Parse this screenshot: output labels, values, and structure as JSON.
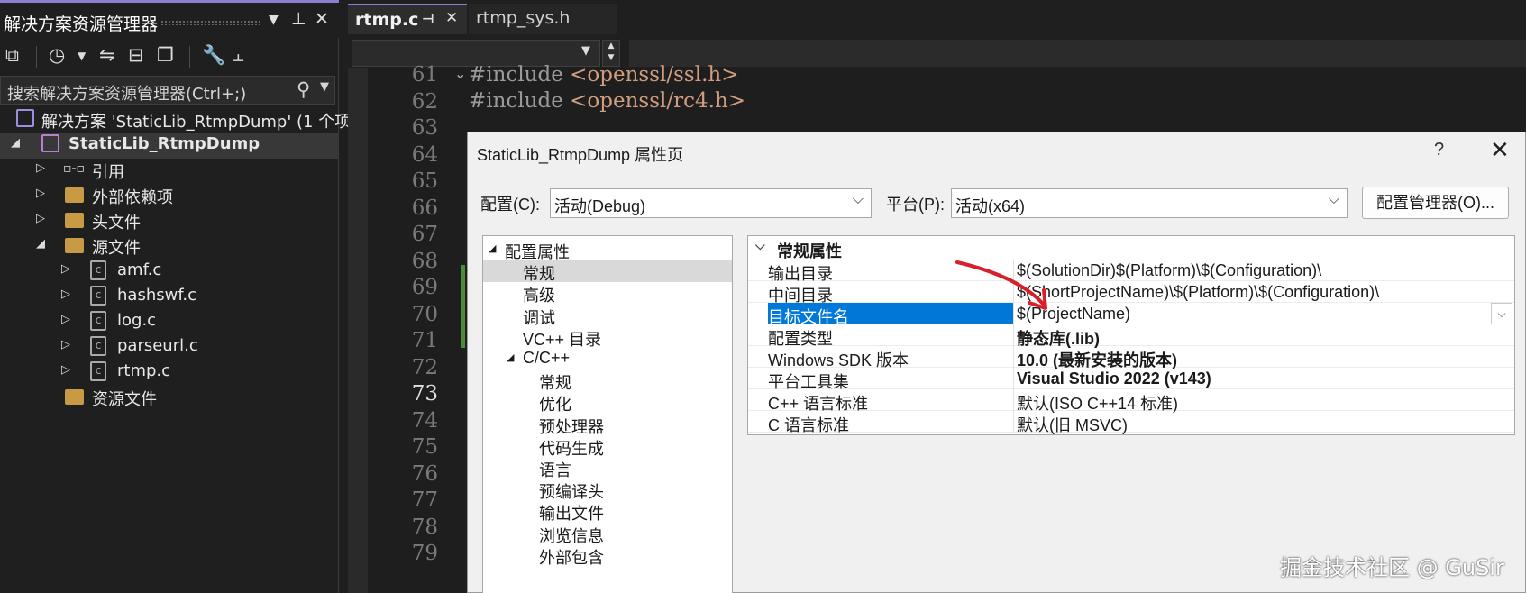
{
  "solution_explorer": {
    "title": "解决方案资源管理器",
    "search_placeholder": "搜索解决方案资源管理器(Ctrl+;)",
    "solution_label": "解决方案 'StaticLib_RtmpDump' (1 个项",
    "project_label": "StaticLib_RtmpDump",
    "items": [
      {
        "label": "引用"
      },
      {
        "label": "外部依赖项"
      },
      {
        "label": "头文件"
      },
      {
        "label": "源文件"
      },
      {
        "label": "amf.c"
      },
      {
        "label": "hashswf.c"
      },
      {
        "label": "log.c"
      },
      {
        "label": "parseurl.c"
      },
      {
        "label": "rtmp.c"
      },
      {
        "label": "资源文件"
      }
    ]
  },
  "editor": {
    "tabs": [
      {
        "label": "rtmp.c"
      },
      {
        "label": "rtmp_sys.h"
      }
    ],
    "line_numbers": [
      "61",
      "62",
      "63",
      "64",
      "65",
      "66",
      "67",
      "68",
      "69",
      "70",
      "71",
      "72",
      "73",
      "74",
      "75",
      "76",
      "77",
      "78",
      "79"
    ],
    "current_line": "73",
    "code": [
      {
        "kw": "#include",
        "hd": "<openssl/ssl.h>"
      },
      {
        "kw": "#include",
        "hd": "<openssl/rc4.h>"
      }
    ]
  },
  "dialog": {
    "title": "StaticLib_RtmpDump 属性页",
    "help": "?",
    "close": "✕",
    "config_label": "配置(C):",
    "config_value": "活动(Debug)",
    "platform_label": "平台(P):",
    "platform_value": "活动(x64)",
    "config_manager_button": "配置管理器(O)...",
    "tree": [
      {
        "label": "配置属性",
        "level": 0,
        "expander": "◢"
      },
      {
        "label": "常规",
        "level": 1,
        "selected": true
      },
      {
        "label": "高级",
        "level": 1
      },
      {
        "label": "调试",
        "level": 1
      },
      {
        "label": "VC++ 目录",
        "level": 1
      },
      {
        "label": "C/C++",
        "level": 1,
        "expander": "◢"
      },
      {
        "label": "常规",
        "level": 2
      },
      {
        "label": "优化",
        "level": 2
      },
      {
        "label": "预处理器",
        "level": 2
      },
      {
        "label": "代码生成",
        "level": 2
      },
      {
        "label": "语言",
        "level": 2
      },
      {
        "label": "预编译头",
        "level": 2
      },
      {
        "label": "输出文件",
        "level": 2
      },
      {
        "label": "浏览信息",
        "level": 2
      },
      {
        "label": "外部包含",
        "level": 2
      }
    ],
    "grid_header": "常规属性",
    "properties": [
      {
        "name": "输出目录",
        "value": "$(SolutionDir)$(Platform)\\$(Configuration)\\",
        "bold": false
      },
      {
        "name": "中间目录",
        "value": "$(ShortProjectName)\\$(Platform)\\$(Configuration)\\",
        "bold": false
      },
      {
        "name": "目标文件名",
        "value": "$(ProjectName)",
        "bold": false,
        "selected": true
      },
      {
        "name": "配置类型",
        "value": "静态库(.lib)",
        "bold": true
      },
      {
        "name": "Windows SDK 版本",
        "value": "10.0 (最新安装的版本)",
        "bold": true
      },
      {
        "name": "平台工具集",
        "value": "Visual Studio 2022 (v143)",
        "bold": true
      },
      {
        "name": "C++ 语言标准",
        "value": "默认(ISO C++14 标准)",
        "bold": false
      },
      {
        "name": "C 语言标准",
        "value": "默认(旧 MSVC)",
        "bold": false
      }
    ]
  },
  "watermark": "掘金技术社区 @ GuSir",
  "colors": {
    "accent": "#8a7fd4",
    "selection": "#0078d7",
    "annotation_arrow": "#d8202a"
  }
}
